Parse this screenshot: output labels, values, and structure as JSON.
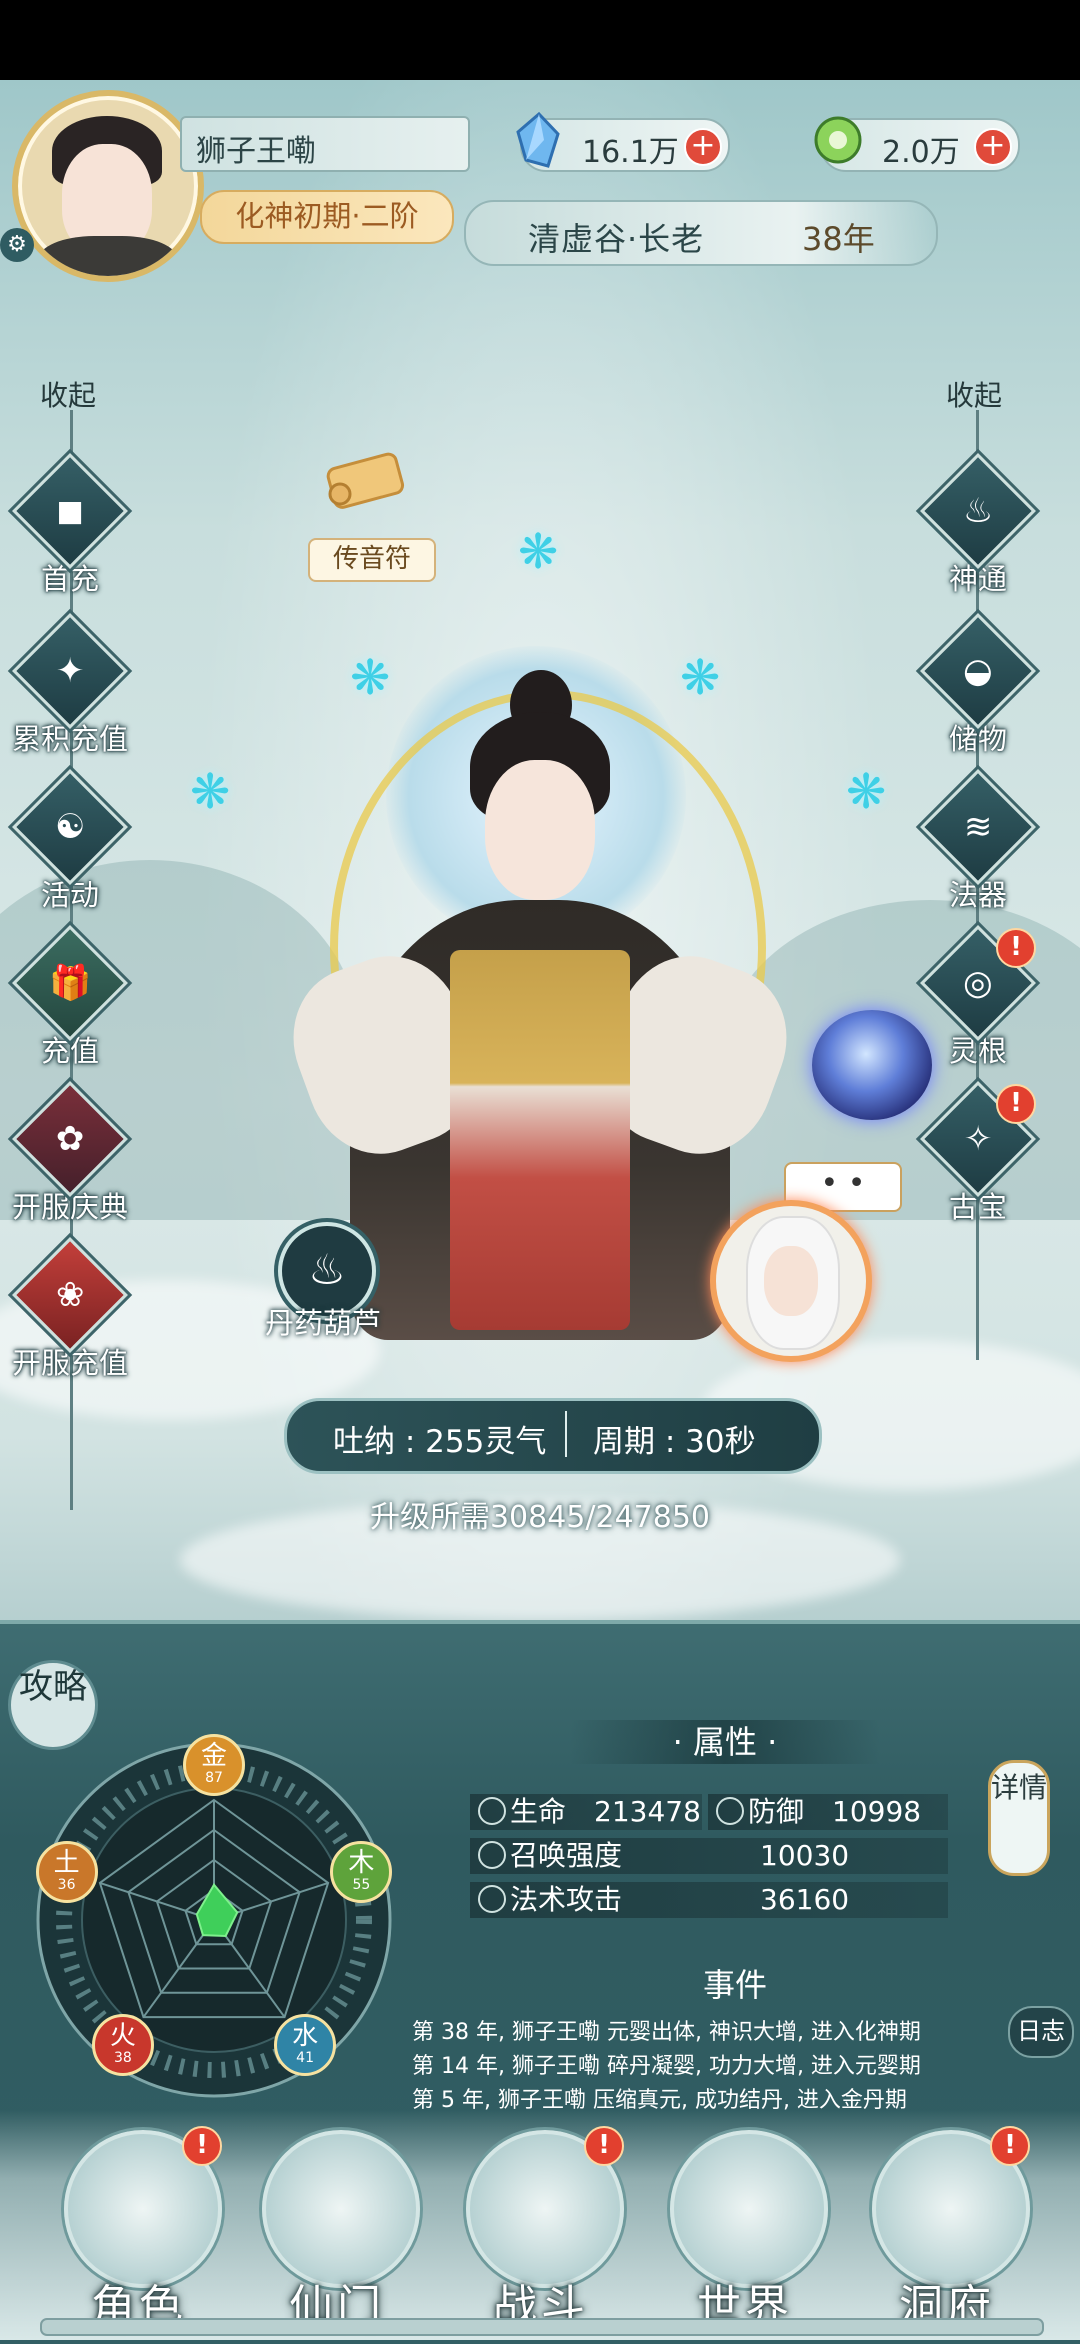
{
  "player": {
    "name": "狮子王嘞",
    "realm": "化神初期·二阶"
  },
  "resources": [
    {
      "icon": "blue-crystal-icon",
      "value": "16.1万"
    },
    {
      "icon": "jade-token-icon",
      "value": "2.0万"
    }
  ],
  "sect": {
    "title": "清虚谷·长老",
    "years": "38年"
  },
  "left_menu": {
    "collapse": "收起",
    "items": [
      {
        "label": "首充",
        "glyph": "◼"
      },
      {
        "label": "累积充值",
        "glyph": "✦"
      },
      {
        "label": "活动",
        "glyph": "☯"
      },
      {
        "label": "充值",
        "glyph": "🎁"
      },
      {
        "label": "开服庆典",
        "glyph": "✿"
      },
      {
        "label": "开服充值",
        "glyph": "❀"
      }
    ]
  },
  "right_menu": {
    "collapse": "收起",
    "items": [
      {
        "label": "神通",
        "glyph": "♨"
      },
      {
        "label": "储物",
        "glyph": "◒"
      },
      {
        "label": "法器",
        "glyph": "≋"
      },
      {
        "label": "灵根",
        "glyph": "◎",
        "badge": "!"
      },
      {
        "label": "古宝",
        "glyph": "✧",
        "badge": "!"
      }
    ]
  },
  "scroll_label": "传音符",
  "pill_gourd_label": "丹药葫芦",
  "npc_bubble": "• •",
  "cultivation": {
    "breath": "吐纳 : 255灵气",
    "cycle": "周期 : 30秒",
    "levelup": "升级所需30845/247850"
  },
  "strategy": "攻略",
  "attributes": {
    "title": "· 属性 ·",
    "hp_label": "生命",
    "hp_value": "213478",
    "def_label": "防御",
    "def_value": "10998",
    "summon_label": "召唤强度",
    "summon_value": "10030",
    "spell_label": "法术攻击",
    "spell_value": "36160",
    "detail": "详情"
  },
  "elements": [
    {
      "name": "金",
      "value": "87",
      "color": "#d9912b"
    },
    {
      "name": "木",
      "value": "55",
      "color": "#5ea33b"
    },
    {
      "name": "水",
      "value": "41",
      "color": "#2f84a6"
    },
    {
      "name": "火",
      "value": "38",
      "color": "#c8372c"
    },
    {
      "name": "土",
      "value": "36",
      "color": "#c9772a"
    }
  ],
  "events": {
    "title": "事件",
    "log": "日志",
    "lines": [
      "第 38 年, 狮子王嘞 元婴出体, 神识大增, 进入化神期",
      "第 14 年, 狮子王嘞 碎丹凝婴, 功力大增, 进入元婴期",
      "第 5 年, 狮子王嘞 压缩真元, 成功结丹, 进入金丹期"
    ]
  },
  "nav": [
    {
      "label": "角色",
      "badge": "!"
    },
    {
      "label": "仙门"
    },
    {
      "label": "战斗",
      "badge": "!"
    },
    {
      "label": "世界"
    },
    {
      "label": "洞府",
      "badge": "!"
    }
  ]
}
